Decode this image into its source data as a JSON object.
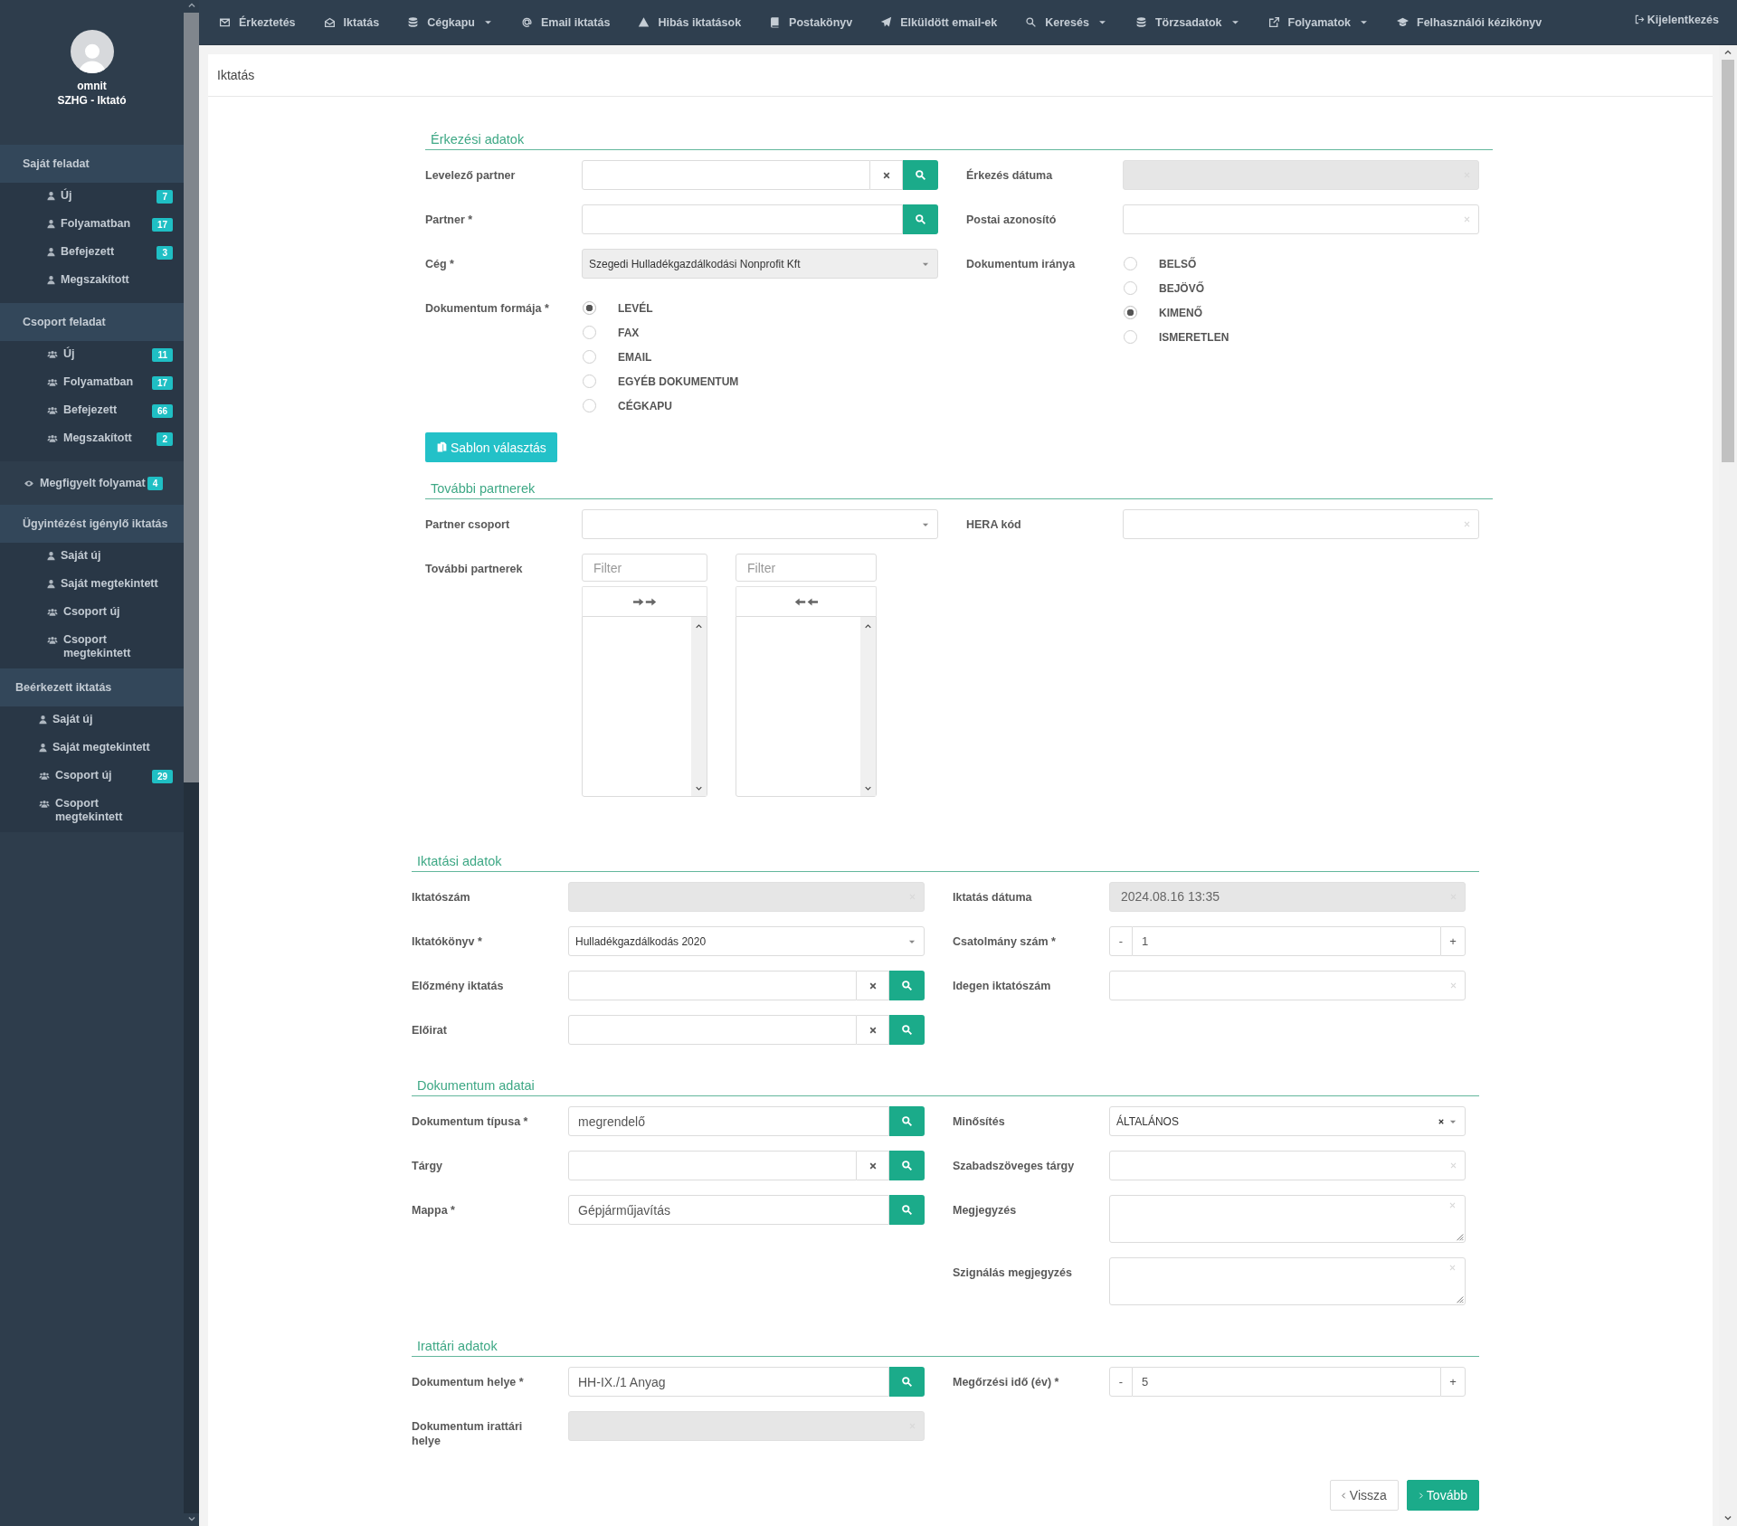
{
  "sidebar": {
    "user_name": "omnit",
    "user_role": "SZHG - Iktató",
    "menu": [
      {
        "kind": "group",
        "title": "Saját feladat",
        "items": [
          {
            "kind": "single",
            "label": "Új",
            "badge": "7"
          },
          {
            "kind": "single",
            "label": "Folyamatban",
            "badge": "17"
          },
          {
            "kind": "single",
            "label": "Befejezett",
            "badge": "3"
          },
          {
            "kind": "single",
            "label": "Megszakított"
          }
        ]
      },
      {
        "kind": "group",
        "title": "Csoport feladat",
        "items": [
          {
            "kind": "team",
            "label": "Új",
            "badge": "11"
          },
          {
            "kind": "team",
            "label": "Folyamatban",
            "badge": "17"
          },
          {
            "kind": "team",
            "label": "Befejezett",
            "badge": "66"
          },
          {
            "kind": "team",
            "label": "Megszakított",
            "badge": "2"
          }
        ]
      },
      {
        "kind": "link",
        "label": "Megfigyelt folyamat",
        "badge": "4"
      },
      {
        "kind": "group",
        "title": "Ügyintézést igénylő iktatás",
        "items": [
          {
            "kind": "single",
            "label": "Saját új"
          },
          {
            "kind": "single",
            "label": "Saját megtekintett"
          },
          {
            "kind": "team",
            "label": "Csoport új"
          },
          {
            "kind": "team",
            "label": "Csoport megtekintett"
          }
        ]
      },
      {
        "kind": "group",
        "title": "Beérkezett iktatás",
        "items": [
          {
            "kind": "single",
            "label": "Saját új"
          },
          {
            "kind": "single",
            "label": "Saját megtekintett"
          },
          {
            "kind": "team",
            "label": "Csoport új",
            "badge": "29"
          },
          {
            "kind": "team",
            "label": "Csoport megtekintett"
          }
        ]
      }
    ]
  },
  "nav": [
    {
      "label": "Érkeztetés",
      "dropdown": false
    },
    {
      "label": "Iktatás",
      "dropdown": false
    },
    {
      "label": "Cégkapu",
      "dropdown": true
    },
    {
      "label": "Email iktatás",
      "dropdown": false
    },
    {
      "label": "Hibás iktatások",
      "dropdown": false
    },
    {
      "label": "Postakönyv",
      "dropdown": false
    },
    {
      "label": "Elküldött email-ek",
      "dropdown": false
    },
    {
      "label": "Keresés",
      "dropdown": true
    },
    {
      "label": "Törzsadatok",
      "dropdown": true
    },
    {
      "label": "Folyamatok",
      "dropdown": true
    },
    {
      "label": "Felhasználói kézikönyv",
      "dropdown": false
    }
  ],
  "logout": "Kijelentkezés",
  "page_title": "Iktatás",
  "sections": [
    {
      "title": "Érkezési adatok",
      "left": [
        {
          "label": "Levelező partner",
          "kind": "lookup",
          "clearable": true
        },
        {
          "label": "Partner *",
          "kind": "lookup",
          "clearable": false
        },
        {
          "label": "Cég *",
          "kind": "select",
          "disabled": true,
          "clearable": false,
          "value": "Szegedi Hulladékgazdálkodási Nonprofit Kft"
        },
        {
          "label": "Dokumentum formája *",
          "kind": "radio",
          "options": [
            {
              "label": "LEVÉL",
              "selected": true
            },
            {
              "label": "FAX",
              "selected": false
            },
            {
              "label": "EMAIL",
              "selected": false
            },
            {
              "label": "EGYÉB DOKUMENTUM",
              "selected": false
            },
            {
              "label": "CÉGKAPU",
              "selected": false
            }
          ]
        }
      ],
      "right": [
        {
          "label": "Érkezés dátuma",
          "kind": "text",
          "disabled": true
        },
        {
          "label": "Postai azonosító",
          "kind": "text",
          "disabled": false
        },
        {
          "label": "Dokumentum iránya",
          "kind": "radio",
          "options": [
            {
              "label": "BELSŐ",
              "selected": false
            },
            {
              "label": "BEJÖVŐ",
              "selected": false
            },
            {
              "label": "KIMENŐ",
              "selected": true
            },
            {
              "label": "ISMERETLEN",
              "selected": false
            }
          ]
        }
      ],
      "button": "Sablon választás"
    },
    {
      "title": "További partnerek",
      "left": [
        {
          "label": "Partner csoport",
          "kind": "select",
          "disabled": false,
          "clearable": false
        },
        {
          "label": "További partnerek",
          "kind": "dual-list",
          "filters": [
            {
              "placeholder": "Filter"
            },
            {
              "placeholder": "Filter"
            }
          ]
        }
      ],
      "right": [
        {
          "label": "HERA kód",
          "kind": "text",
          "disabled": false
        }
      ]
    },
    {
      "title": "Iktatási adatok",
      "left": [
        {
          "label": "Iktatószám",
          "kind": "text",
          "disabled": true
        },
        {
          "label": "Iktatókönyv *",
          "kind": "select",
          "disabled": false,
          "clearable": false,
          "value": "Hulladékgazdálkodás 2020"
        },
        {
          "label": "Előzmény iktatás",
          "kind": "lookup",
          "clearable": true
        },
        {
          "label": "Előirat",
          "kind": "lookup",
          "clearable": true
        }
      ],
      "right": [
        {
          "label": "Iktatás dátuma",
          "kind": "text",
          "disabled": true,
          "value": "2024.08.16 13:35"
        },
        {
          "label": "Csatolmány szám *",
          "kind": "spinner",
          "value": "1",
          "minus": "-",
          "plus": "+"
        },
        {
          "label": "Idegen iktatószám",
          "kind": "text",
          "disabled": false
        }
      ]
    },
    {
      "title": "Dokumentum adatai",
      "left": [
        {
          "label": "Dokumentum típusa *",
          "kind": "lookup",
          "clearable": false,
          "value": "megrendelő"
        },
        {
          "label": "Tárgy",
          "kind": "lookup",
          "clearable": true
        },
        {
          "label": "Mappa *",
          "kind": "lookup",
          "clearable": false,
          "value": "Gépjárműjavítás"
        }
      ],
      "right": [
        {
          "label": "Minősítés",
          "kind": "select",
          "disabled": false,
          "clearable": true,
          "value": "ÁLTALÁNOS"
        },
        {
          "label": "Szabadszöveges tárgy",
          "kind": "text",
          "disabled": false
        },
        {
          "label": "Megjegyzés",
          "kind": "textarea"
        },
        {
          "label": "Szignálás megjegyzés",
          "kind": "textarea"
        }
      ]
    },
    {
      "title": "Irattári adatok",
      "left": [
        {
          "label": "Dokumentum helye *",
          "kind": "lookup",
          "clearable": false,
          "value": "HH-IX./1 Anyag"
        },
        {
          "label": "Dokumentum irattári helye",
          "kind": "text",
          "disabled": true
        }
      ],
      "right": [
        {
          "label": "Megőrzési idő (év) *",
          "kind": "spinner",
          "value": "5",
          "minus": "-",
          "plus": "+"
        }
      ]
    }
  ],
  "actions": [
    {
      "kind": "back",
      "label": "Vissza"
    },
    {
      "kind": "next",
      "label": "Tovább"
    }
  ]
}
